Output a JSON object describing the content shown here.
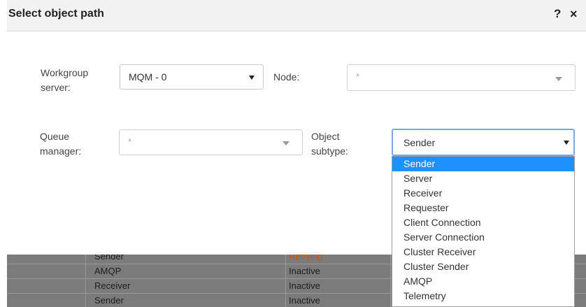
{
  "dialog": {
    "title": "Select object path",
    "help_label": "?",
    "close_label": "×"
  },
  "form": {
    "workgroup_label_1": "Workgroup",
    "workgroup_label_2": "server:",
    "workgroup_value": "MQM - 0",
    "node_label": "Node:",
    "node_placeholder": "*",
    "qm_label_1": "Queue",
    "qm_label_2": "manager:",
    "qm_placeholder": "*",
    "subtype_label_1": "Object",
    "subtype_label_2": "subtype:",
    "subtype_value": "Sender"
  },
  "subtype_options": [
    "Sender",
    "Server",
    "Receiver",
    "Requester",
    "Client Connection",
    "Server Connection",
    "Cluster Receiver",
    "Cluster Sender",
    "AMQP",
    "Telemetry"
  ],
  "background_rows": [
    {
      "type": "Sender",
      "status": "Retrying"
    },
    {
      "type": "AMQP",
      "status": "Inactive"
    },
    {
      "type": "Receiver",
      "status": "Inactive"
    },
    {
      "type": "Sender",
      "status": "Inactive"
    }
  ],
  "colors": {
    "selected_option": "#1e90ff",
    "retrying_status": "#c8561e",
    "focus_border": "#7ea6e0"
  }
}
